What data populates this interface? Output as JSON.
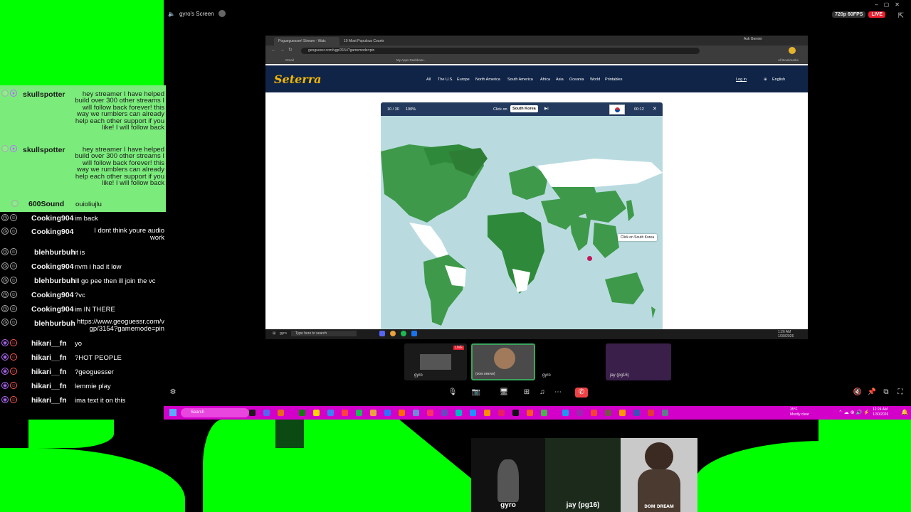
{
  "screen_share": {
    "title": "gyro's Screen",
    "quality": "720p 60FPS",
    "live_badge": "LIVE"
  },
  "chat": [
    {
      "user": "skullspotter",
      "msg": "hey streamer I have helped build over 300 other streams I will follow back forever! this way we rumblers can already help each other support if you like! I will follow back"
    },
    {
      "user": "skullspotter",
      "msg": "hey streamer I have helped build over 300 other streams I will follow back forever! this way we rumblers can already help each other support if you like! I will follow back"
    },
    {
      "user": "600Sound",
      "msg": "ouioliujlu"
    },
    {
      "user": "Cooking904",
      "msg": "im back"
    },
    {
      "user": "Cooking904",
      "msg": "I dont think youre audio work"
    },
    {
      "user": "blehburbuh",
      "msg": "it is"
    },
    {
      "user": "Cooking904",
      "msg": "nvm i had it low"
    },
    {
      "user": "blehburbuh",
      "msg": "ill go pee then ill join the vc"
    },
    {
      "user": "Cooking904",
      "msg": "?vc"
    },
    {
      "user": "Cooking904",
      "msg": "im IN THERE"
    },
    {
      "user": "blehburbuh",
      "msg": "https://www.geoguessr.com/vgp/3154?gamemode=pin"
    },
    {
      "user": "hikari__fn",
      "msg": "yo"
    },
    {
      "user": "hikari__fn",
      "msg": "?HOT PEOPLE"
    },
    {
      "user": "hikari__fn",
      "msg": "?geoguesser"
    },
    {
      "user": "hikari__fn",
      "msg": "lemmie play"
    },
    {
      "user": "hikari__fn",
      "msg": "ima text it on this"
    }
  ],
  "browser": {
    "tabs": [
      "Pogueguesser! Stream - Watc",
      "10 Most Populous Countr"
    ],
    "url": "geoguessr.com/vgp/3154?gamemode=pin",
    "bookmarks": [
      "Gmail",
      "My Apps Dashboar..."
    ],
    "ask_gemini": "Ask Gemini",
    "all_bookmarks": "All Bookmarks"
  },
  "site": {
    "logo": "Seterra",
    "nav": [
      "All",
      "The U.S.",
      "Europe",
      "North America",
      "South America",
      "Africa",
      "Asia",
      "Oceania",
      "World",
      "Printables"
    ],
    "login": "Log in",
    "language": "English"
  },
  "game": {
    "progress": "10 / 30",
    "score": "100%",
    "prompt": "Click on",
    "target": "South Korea",
    "timer": "00:12",
    "tooltip": "Click on South Korea"
  },
  "inner_taskbar": {
    "user": "gyro",
    "search_placeholder": "Type here to search",
    "time": "1:26 AM",
    "date": "1/30/2026"
  },
  "participants": {
    "tile_label_1": "gyro",
    "tile_label_2": "(ᴅᴏᴍ ᴅʀᴇᴀᴍ)",
    "tile_label_3": "gyro",
    "tile_label_4": "jay (pg16)",
    "live": "LIVE"
  },
  "taskbar": {
    "search_placeholder": "Search",
    "weather_temp": "35°F",
    "weather_desc": "Mostly clear",
    "time": "12:24 AM",
    "date": "1/30/2026"
  },
  "cams": {
    "cam1_name": "gyro",
    "cam2_name": "jay (pg16)",
    "cam3_name": "ᴅᴏᴍ ᴅʀᴇᴀᴍ"
  },
  "colors": {
    "green_screen": "#00ff00",
    "taskbar": "#d200c9",
    "site_nav": "#0f2447",
    "logo": "#f2b705",
    "map_ocean": "#b9dbe0",
    "map_land_done": "#3e9a4a",
    "map_land_todo": "#ffffff"
  }
}
